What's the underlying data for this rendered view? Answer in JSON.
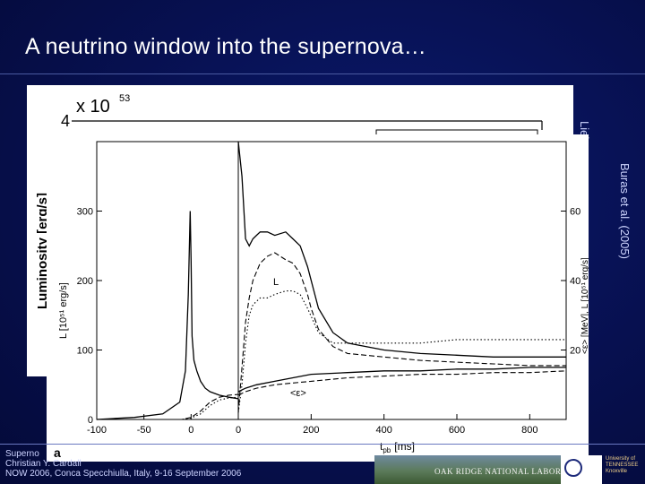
{
  "slide": {
    "title": "A neutrino window into the supernova…",
    "citation_back": "Lieber",
    "citation_front": "Buras et al. (2005)"
  },
  "footer": {
    "line1": "Superno",
    "line2": "Christian Y. Cardall",
    "line3": "NOW 2006, Conca Specchiulla, Italy, 9-16 September 2006"
  },
  "logos": {
    "ornl": "OAK RIDGE NATIONAL LABORATORY",
    "ut": [
      "University of",
      "TENNESSEE",
      "Knoxville"
    ]
  },
  "back_plot": {
    "multiplier": "x 10",
    "exponent": "53",
    "tick_label": "4",
    "ylabel": "Luminosity [erg/s]"
  },
  "chart_data": {
    "type": "line",
    "panel_label": "a",
    "xlabel_main": "t",
    "xlabel_sub": "pb",
    "xlabel_unit": "[ms]",
    "ylabel_left": "L [10⁵¹ erg/s]",
    "ylabel_right": "<ε> [MeV], L [10⁵¹ erg/s]",
    "annotations": [
      "L",
      "<ε>"
    ],
    "left_panel": {
      "xlim": [
        -100,
        50
      ],
      "ylim": [
        0,
        400
      ],
      "xticks": [
        -100,
        -50,
        0
      ],
      "yticks": [
        0,
        100,
        200,
        300
      ],
      "series": [
        {
          "style": "solid",
          "x": [
            -100,
            -60,
            -30,
            -12,
            -6,
            -3,
            -1,
            0,
            1,
            3,
            6,
            10,
            15,
            20,
            30,
            40,
            50
          ],
          "y": [
            0,
            3,
            8,
            25,
            70,
            180,
            300,
            230,
            120,
            85,
            70,
            55,
            45,
            40,
            35,
            32,
            30
          ]
        },
        {
          "style": "dashed",
          "x": [
            -100,
            -30,
            -10,
            0,
            10,
            20,
            30,
            40,
            50
          ],
          "y": [
            0,
            0,
            0,
            3,
            12,
            25,
            32,
            35,
            36
          ]
        },
        {
          "style": "dotted",
          "x": [
            -100,
            -30,
            -10,
            0,
            10,
            20,
            30,
            40,
            50
          ],
          "y": [
            0,
            0,
            0,
            2,
            8,
            20,
            28,
            31,
            32
          ]
        }
      ]
    },
    "right_panel": {
      "xlim": [
        0,
        900
      ],
      "ylim": [
        0,
        80
      ],
      "xticks": [
        0,
        200,
        400,
        600,
        800
      ],
      "yticks": [
        20,
        40,
        60
      ],
      "series": [
        {
          "style": "solid",
          "x": [
            0,
            10,
            20,
            30,
            40,
            50,
            60,
            80,
            100,
            130,
            150,
            170,
            190,
            220,
            260,
            300,
            400,
            500,
            600,
            700,
            800,
            900
          ],
          "y": [
            80,
            70,
            52,
            50,
            52,
            53,
            54,
            54,
            53,
            54,
            52,
            50,
            44,
            32,
            25,
            22,
            20,
            19,
            18.5,
            18,
            18,
            18
          ]
        },
        {
          "style": "dashed",
          "x": [
            0,
            10,
            20,
            30,
            40,
            60,
            80,
            100,
            130,
            150,
            170,
            190,
            200,
            220,
            260,
            300,
            400,
            500,
            600,
            700,
            800,
            900
          ],
          "y": [
            2,
            15,
            28,
            35,
            40,
            45,
            47,
            48,
            46,
            45,
            42,
            36,
            32,
            26,
            21,
            19,
            18,
            17,
            16.5,
            16,
            15.5,
            15.5
          ]
        },
        {
          "style": "dotted",
          "x": [
            0,
            10,
            20,
            30,
            40,
            60,
            80,
            100,
            130,
            150,
            170,
            190,
            220,
            260,
            300,
            400,
            500,
            600,
            700,
            800,
            900
          ],
          "y": [
            2,
            10,
            22,
            30,
            33,
            35,
            35,
            36,
            37,
            37,
            36,
            32,
            25,
            22,
            22,
            22,
            22,
            23,
            23,
            23,
            23
          ]
        },
        {
          "style": "solid",
          "x": [
            0,
            20,
            50,
            100,
            150,
            200,
            300,
            400,
            500,
            600,
            700,
            800,
            900
          ],
          "y": [
            8,
            9,
            10,
            11,
            12,
            13,
            13.5,
            14,
            14,
            14.5,
            14.5,
            15,
            15
          ]
        },
        {
          "style": "dashed",
          "x": [
            0,
            20,
            50,
            100,
            150,
            200,
            300,
            400,
            500,
            600,
            700,
            800,
            900
          ],
          "y": [
            7,
            8,
            9,
            10,
            10.5,
            11,
            12,
            12.5,
            13,
            13,
            13.5,
            13.5,
            14
          ]
        }
      ]
    }
  }
}
